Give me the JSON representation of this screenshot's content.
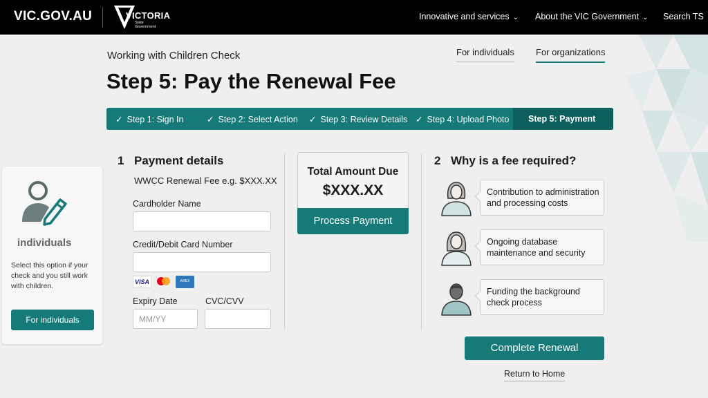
{
  "header": {
    "site_logo": "VIC.GOV.AU",
    "vic_logo_word": "VICTORIA",
    "vic_logo_sub_1": "State",
    "vic_logo_sub_2": "Government",
    "nav": [
      {
        "label": "Innovative and services",
        "icon": "chevron-down-icon"
      },
      {
        "label": "About the VIC Government",
        "icon": "chevron-down-icon"
      },
      {
        "label": "Search TS"
      }
    ]
  },
  "page": {
    "eyebrow": "Working with Children Check",
    "title": "Step 5: Pay the Renewal Fee",
    "audience_tabs": [
      "For individuals",
      "For organizations"
    ],
    "active_tab": "For organizations"
  },
  "stepper": {
    "steps": [
      "Step 1: Sign In",
      "Step 2: Select Action",
      "Step 3: Review Details",
      "Step 4: Upload Photo",
      "Step 5: Payment"
    ],
    "check_glyph": "✓",
    "active_index": 4
  },
  "side_card": {
    "title": "individuals",
    "text": "Select this option if your check and you still work with children.",
    "button": "For individuals",
    "icon": "person-edit-icon"
  },
  "payment": {
    "number": "1",
    "title": "Payment details",
    "fee_line": "WWCC Renewal Fee e.g. $XXX.XX",
    "cardholder_label": "Cardholder Name",
    "cardholder_value": "",
    "card_label": "Credit/Debit Card Number",
    "card_value": "",
    "card_logos": [
      "VISA",
      "mastercard",
      "AMEX"
    ],
    "expiry_label": "Expiry Date",
    "expiry_placeholder": "MM/YY",
    "cvc_label": "CVC/CVV",
    "cvc_value": ""
  },
  "total": {
    "label": "Total Amount Due",
    "amount": "$XXX.XX",
    "button": "Process Payment"
  },
  "why": {
    "number": "2",
    "title": "Why is a fee required?",
    "reasons": [
      "Contribution to administration and processing costs",
      "Ongoing database maintenance and security",
      "Funding the background check process"
    ]
  },
  "actions": {
    "complete": "Complete Renewal",
    "home": "Return to Home"
  },
  "colors": {
    "brand_teal": "#157a78",
    "header_bg": "#000000",
    "page_bg": "#efefef"
  }
}
